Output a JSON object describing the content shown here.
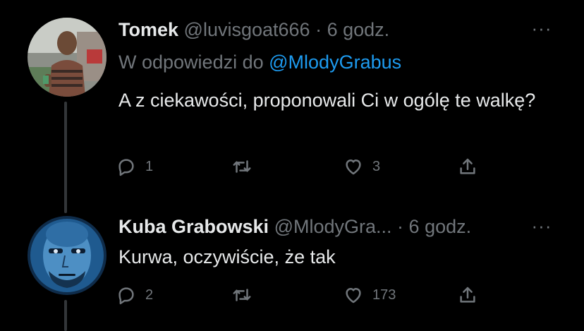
{
  "tweets": [
    {
      "name": "Tomek",
      "handle": "@luvisgoat666",
      "separator": "·",
      "time": "6 godz.",
      "reply_prefix": "W odpowiedzi do",
      "reply_mention": "@MlodyGrabus",
      "text": "A z ciekawości, proponowali Ci w ogólę te walkę?",
      "replies": "1",
      "retweets": "",
      "likes": "3"
    },
    {
      "name": "Kuba Grabowski",
      "handle": "@MlodyGra...",
      "separator": "·",
      "time": "6 godz.",
      "text": "Kurwa, oczywiście, że tak",
      "replies": "2",
      "retweets": "",
      "likes": "173"
    }
  ],
  "more_glyph": "···",
  "colors": {
    "background": "#000000",
    "text": "#e7e9ea",
    "muted": "#71767b",
    "link": "#1d9bf0",
    "thread_line": "#333639"
  },
  "icons": [
    "reply-icon",
    "retweet-icon",
    "like-icon",
    "share-icon",
    "more-icon"
  ]
}
